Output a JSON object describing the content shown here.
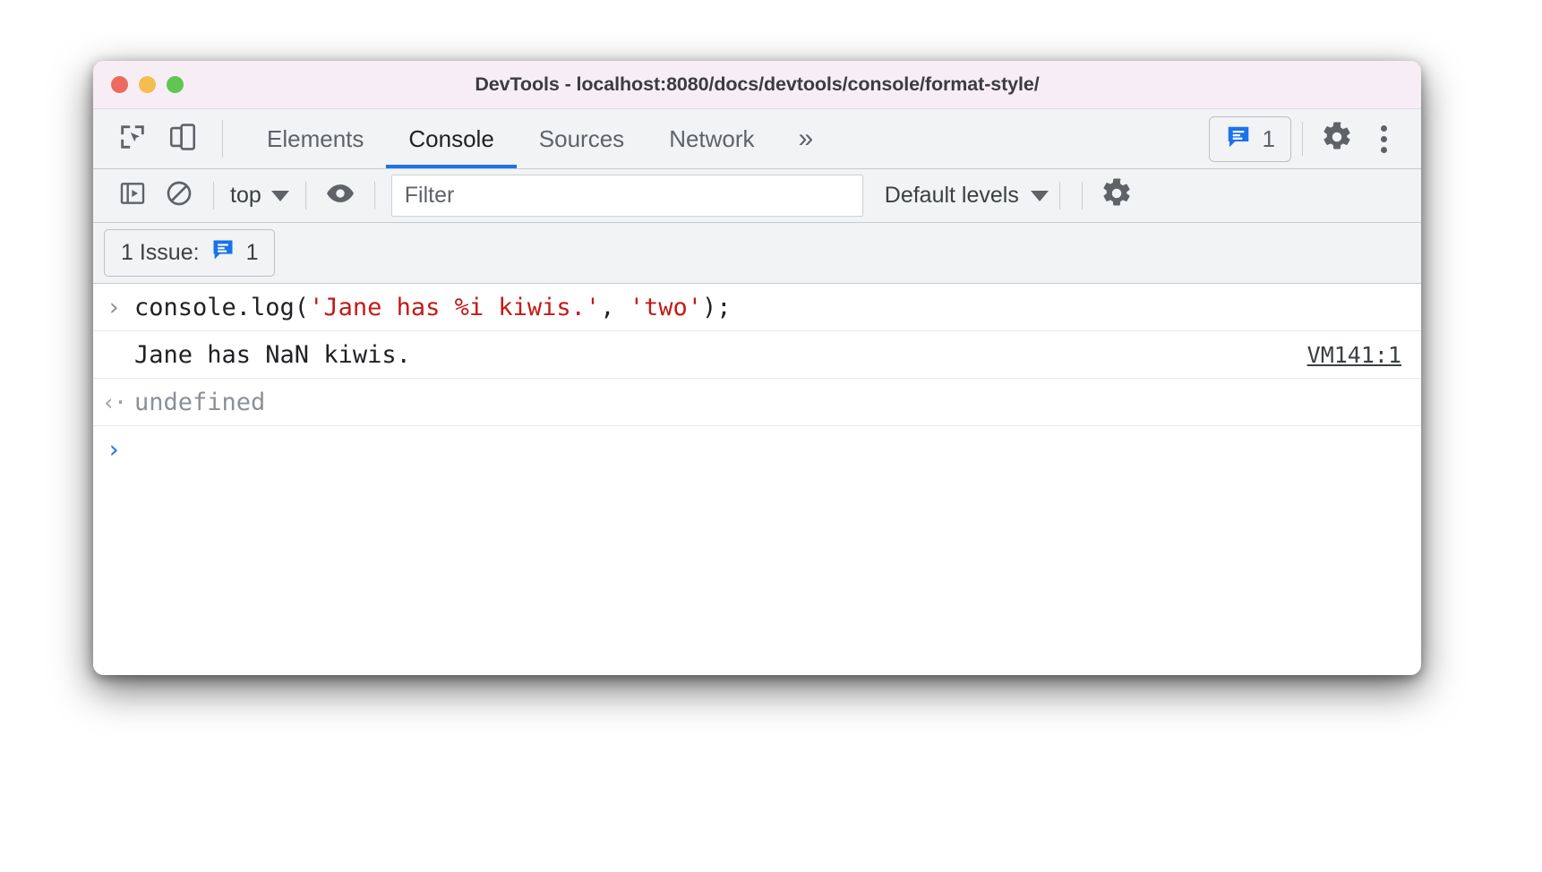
{
  "window": {
    "title": "DevTools - localhost:8080/docs/devtools/console/format-style/",
    "traffic_lights": [
      "close",
      "minimize",
      "zoom"
    ]
  },
  "tabbar": {
    "inspect_icon": "inspect-element-icon",
    "device_icon": "device-toolbar-icon",
    "tabs": [
      {
        "label": "Elements",
        "active": false
      },
      {
        "label": "Console",
        "active": true
      },
      {
        "label": "Sources",
        "active": false
      },
      {
        "label": "Network",
        "active": false
      }
    ],
    "overflow_label": "»",
    "issues_icon": "issue-bubble-icon",
    "issues_count": "1",
    "settings_icon": "gear-icon",
    "more_icon": "kebab-menu-icon"
  },
  "console_toolbar": {
    "sidebar_icon": "console-sidebar-icon",
    "clear_icon": "clear-console-icon",
    "context_label": "top",
    "context_caret": "▼",
    "eye_icon": "live-expression-icon",
    "filter_placeholder": "Filter",
    "filter_value": "",
    "levels_label": "Default levels",
    "levels_caret": "▼",
    "settings_icon": "console-settings-gear-icon"
  },
  "issues_strip": {
    "label": "1 Issue:",
    "badge_icon": "issue-bubble-icon",
    "count": "1"
  },
  "console_rows": [
    {
      "type": "input",
      "gutter": "›",
      "segments": [
        {
          "text": "console.log(",
          "kind": "plain"
        },
        {
          "text": "'Jane has %i kiwis.'",
          "kind": "string"
        },
        {
          "text": ", ",
          "kind": "plain"
        },
        {
          "text": "'two'",
          "kind": "string"
        },
        {
          "text": ");",
          "kind": "plain"
        }
      ],
      "source": ""
    },
    {
      "type": "output",
      "gutter": "",
      "text": "Jane has NaN kiwis.",
      "source": "VM141:1"
    },
    {
      "type": "result",
      "gutter": "‹·",
      "text": "undefined",
      "source": ""
    },
    {
      "type": "prompt",
      "gutter": "›",
      "text": "",
      "source": ""
    }
  ],
  "colors": {
    "accent_blue": "#1a73e8",
    "string_red": "#c41a16",
    "titlebar_bg": "#f7eef5",
    "toolbar_bg": "#f1f3f4"
  }
}
